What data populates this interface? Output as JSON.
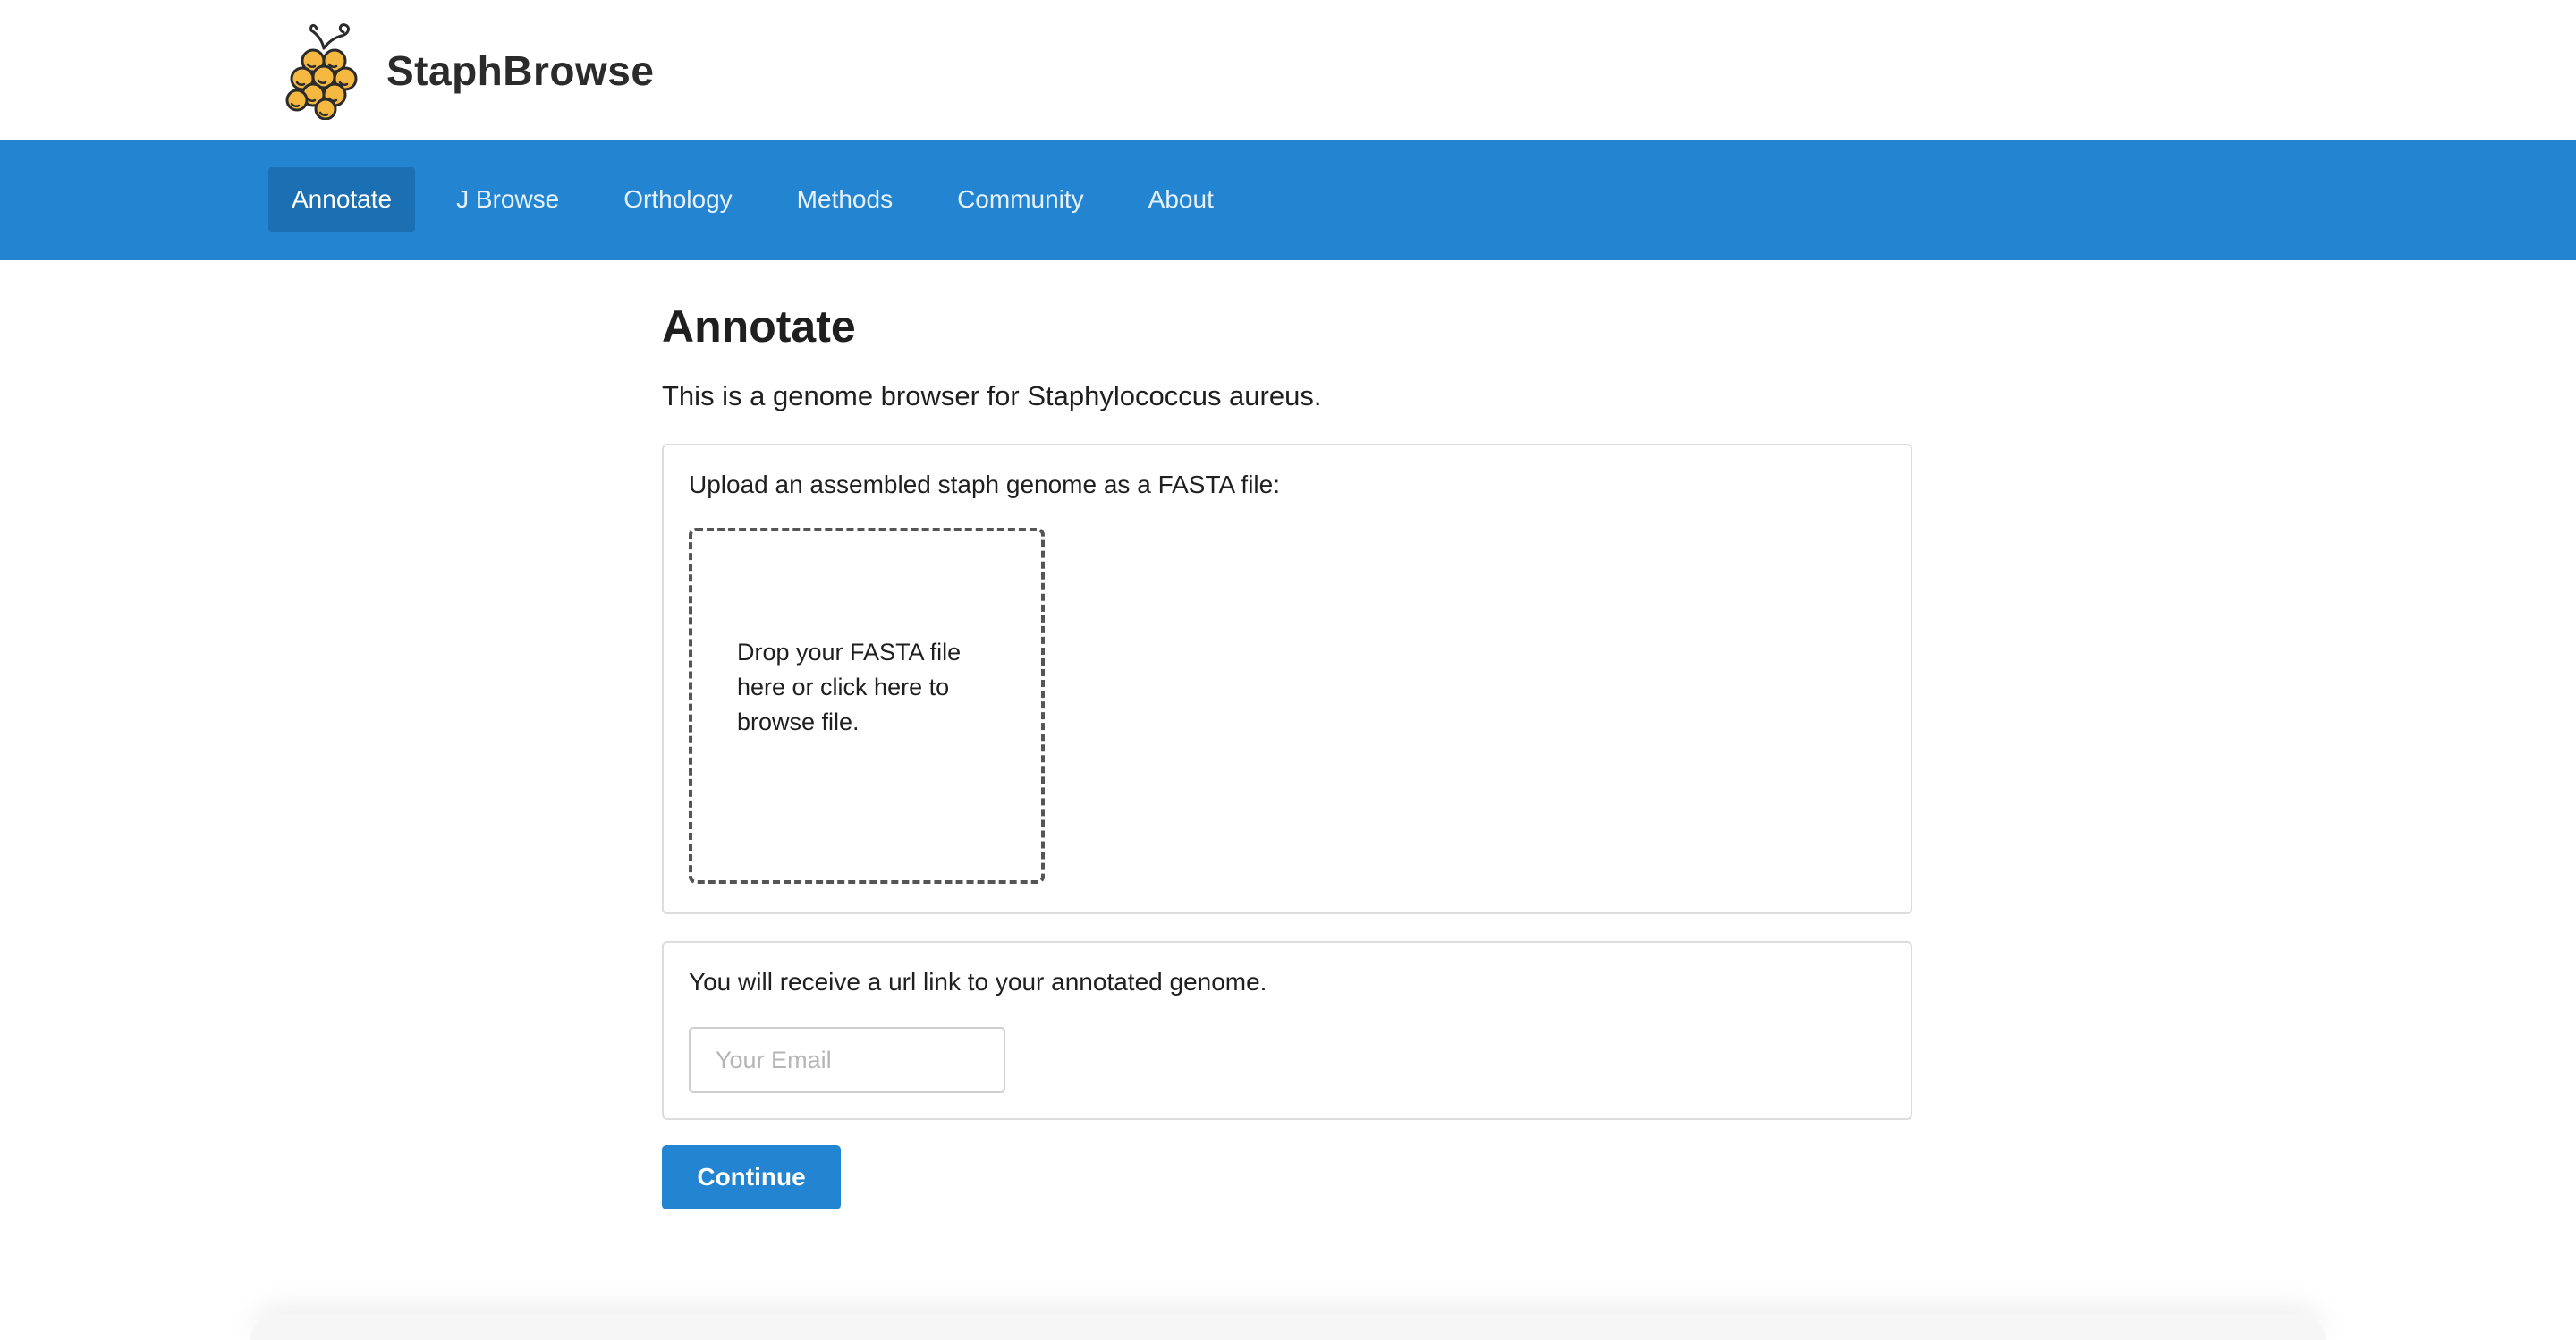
{
  "brand": {
    "name": "StaphBrowse",
    "logo_icon": "grape-cluster-icon"
  },
  "nav": {
    "items": [
      {
        "label": "Annotate",
        "active": true
      },
      {
        "label": "J Browse",
        "active": false
      },
      {
        "label": "Orthology",
        "active": false
      },
      {
        "label": "Methods",
        "active": false
      },
      {
        "label": "Community",
        "active": false
      },
      {
        "label": "About",
        "active": false
      }
    ]
  },
  "main": {
    "title": "Annotate",
    "intro": "This is a genome browser for Staphylococcus aureus."
  },
  "upload": {
    "label": "Upload an assembled staph genome as a FASTA file:",
    "dropzone_text": "Drop your FASTA file here or click here to browse file."
  },
  "email": {
    "label": "You will receive a url link to your annotated genome.",
    "value": "",
    "placeholder": "Your Email"
  },
  "actions": {
    "continue_label": "Continue"
  },
  "colors": {
    "nav_background": "#2385d1",
    "nav_active": "#1b6fb3",
    "button": "#2385d1",
    "logo_fill": "#f5b942",
    "logo_stroke": "#2b2b2b"
  }
}
